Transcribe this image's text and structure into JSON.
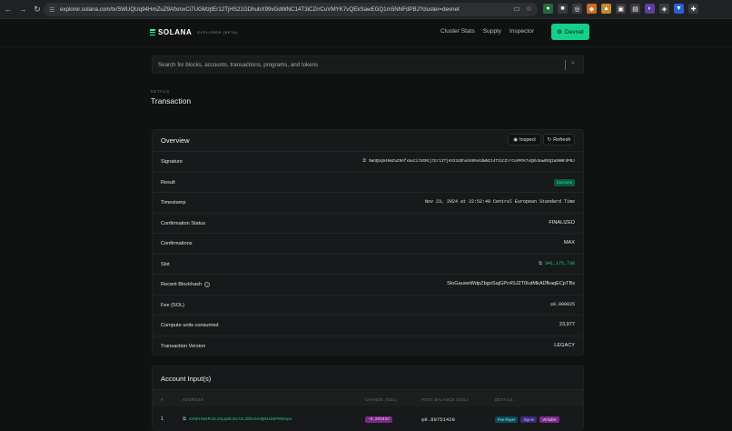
{
  "browser": {
    "url": "explorer.solana.com/tx/5WUQUq94HmZuZ9AfxmxCi7UGMzjtEr12TjHS21GDhubX99vGdWNC14T3iCZrrCuVMYK7vQEkSawEGQ1m5NNFdPBJ?cluster=devnet"
  },
  "header": {
    "logo": "SOLANA",
    "logo_sub": "EXPLORER (BETA)",
    "nav": [
      "Cluster Stats",
      "Supply",
      "Inspector"
    ],
    "cluster_button": "Devnet"
  },
  "search": {
    "placeholder": "Search for blocks, accounts, transactions, programs, and tokens"
  },
  "page": {
    "details_label": "DETAILS",
    "title": "Transaction"
  },
  "overview": {
    "title": "Overview",
    "inspect_label": "Inspect",
    "refresh_label": "Refresh",
    "rows": [
      {
        "label": "Signature",
        "value": "5WUQUq94HmZuZ9AfxmxCi7UGMzjtEr12TjHS21GDhubX99vGdWNC14T3iCZrrCuVMYK7vQEkSawEGQ1m5NNFdPBJ"
      },
      {
        "label": "Result",
        "value": "Success"
      },
      {
        "label": "Timestamp",
        "value": "Nov 23, 2024 at 22:52:49 Central European Standard Time"
      },
      {
        "label": "Confirmation Status",
        "value": "FINALIZED"
      },
      {
        "label": "Confirmations",
        "value": "MAX"
      },
      {
        "label": "Slot",
        "value": "341,175,736"
      },
      {
        "label": "Recent Blockhash",
        "value": "SioGauwsWdpZbgoSajGPc4SJ2T0tutMkADfkaqECpTBs"
      },
      {
        "label": "Fee (SOL)",
        "value": "◎0.000025"
      },
      {
        "label": "Compute units consumed",
        "value": "23,977"
      },
      {
        "label": "Transaction Version",
        "value": "LEGACY"
      }
    ]
  },
  "accounts": {
    "title": "Account Input(s)",
    "columns": [
      "#",
      "ADDRESS",
      "CHANGE (SOL)",
      "POST BALANCE (SOL)",
      "DETAILS"
    ],
    "rows": [
      {
        "index": "1",
        "address": "4e5KYsW4Ps2L2UyqmEzmx72L3bhn3vUQH4uSHPHk8vpn",
        "change": "-0.281633",
        "post_balance": "◎9.89751428",
        "badges": [
          "Fee Payer",
          "Signer",
          "Writable"
        ]
      }
    ]
  },
  "colors": {
    "accent": "#14d08b",
    "background": "#101211",
    "card": "#17191a"
  }
}
